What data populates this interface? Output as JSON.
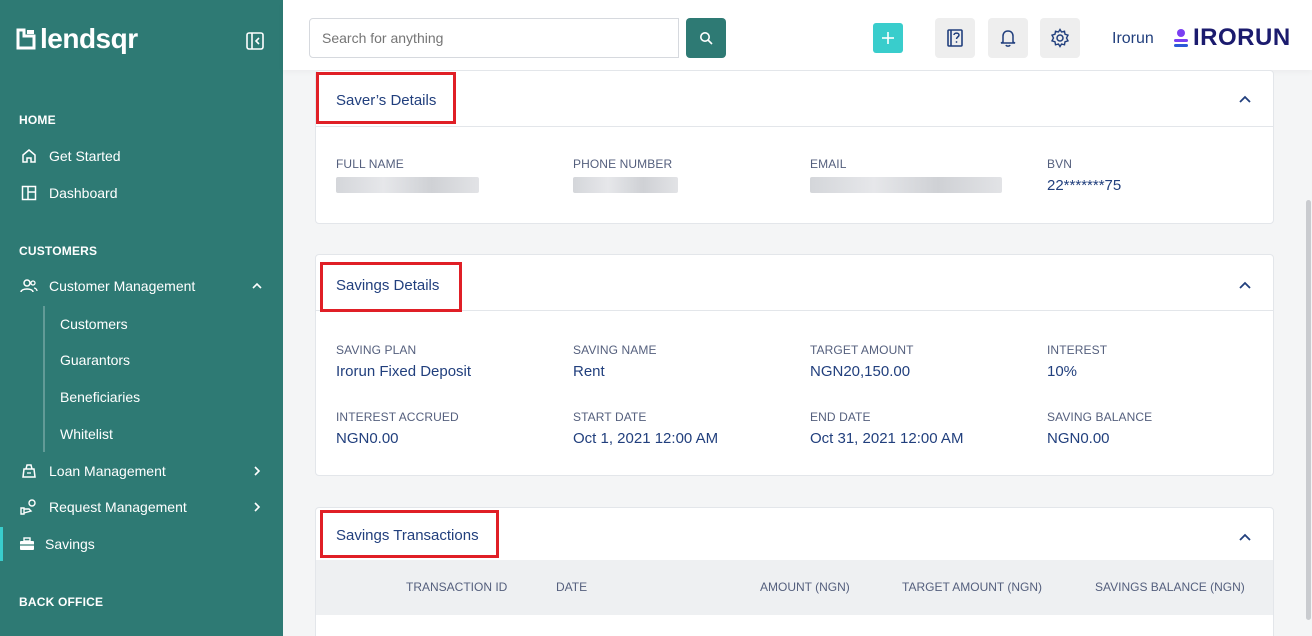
{
  "brand": {
    "logo_text": "lendsqr",
    "partner_text": "Irorun"
  },
  "search": {
    "placeholder": "Search for anything"
  },
  "topbar": {
    "username": "Irorun",
    "icons": [
      "search-icon",
      "plus-icon",
      "help-icon",
      "bell-icon",
      "gear-icon"
    ]
  },
  "sidebar": {
    "sections": {
      "home": "HOME",
      "customers": "CUSTOMERS",
      "back_office": "BACK OFFICE"
    },
    "items": {
      "get_started": "Get Started",
      "dashboard": "Dashboard",
      "customer_management": "Customer Management",
      "loan_management": "Loan Management",
      "request_management": "Request Management",
      "savings": "Savings"
    },
    "sub_items": [
      "Customers",
      "Guarantors",
      "Beneficiaries",
      "Whitelist"
    ]
  },
  "saver": {
    "title": "Saver’s Details",
    "fields": [
      {
        "label": "FULL NAME",
        "value": ""
      },
      {
        "label": "PHONE NUMBER",
        "value": ""
      },
      {
        "label": "EMAIL",
        "value": ""
      },
      {
        "label": "BVN",
        "value": "22*******75"
      }
    ]
  },
  "savings": {
    "title": "Savings Details",
    "fields": [
      {
        "label": "SAVING PLAN",
        "value": "Irorun Fixed Deposit"
      },
      {
        "label": "SAVING NAME",
        "value": "Rent"
      },
      {
        "label": "TARGET AMOUNT",
        "value": "NGN20,150.00"
      },
      {
        "label": "INTEREST",
        "value": "10%"
      },
      {
        "label": "INTEREST ACCRUED",
        "value": "NGN0.00"
      },
      {
        "label": "START DATE",
        "value": "Oct 1, 2021 12:00 AM"
      },
      {
        "label": "END DATE",
        "value": "Oct 31, 2021 12:00 AM"
      },
      {
        "label": "SAVING BALANCE",
        "value": "NGN0.00"
      }
    ]
  },
  "transactions": {
    "title": "Savings Transactions",
    "columns": [
      "TRANSACTION ID",
      "DATE",
      "AMOUNT (NGN)",
      "TARGET AMOUNT (NGN)",
      "SAVINGS BALANCE (NGN)"
    ]
  },
  "colors": {
    "sidebar_bg": "#2e7a74",
    "accent": "#39cdcc",
    "text_primary": "#213f7d",
    "highlight_box": "#e01f26"
  }
}
